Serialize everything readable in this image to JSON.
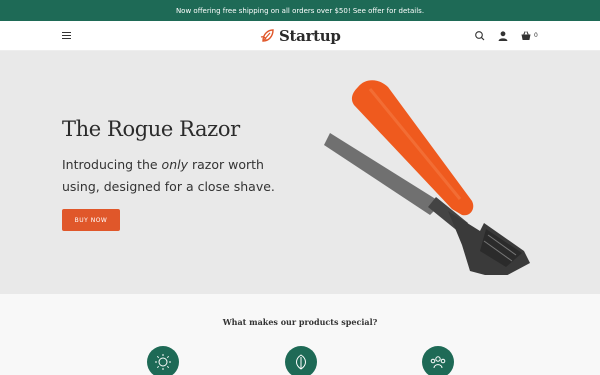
{
  "announcement": {
    "text": "Now offering free shipping on all orders over $50! See offer for details."
  },
  "header": {
    "menu_icon": "hamburger-menu-icon",
    "logo_text": "Startup",
    "logo_icon": "leaf-logo-icon",
    "icons": [
      "search-icon",
      "account-icon",
      "cart-icon"
    ],
    "cart_count": "0"
  },
  "hero": {
    "title": "The Rogue Razor",
    "subtitle_before": "Introducing the ",
    "subtitle_emphasis": "only",
    "subtitle_after": " razor worth using, designed for a close shave.",
    "button_label": "BUY NOW",
    "image": "razor-product-image"
  },
  "features": {
    "title": "What makes our products special?",
    "icons": [
      "sun-icon",
      "leaf-icon",
      "community-icon"
    ]
  },
  "colors": {
    "brand_green": "#1e6a56",
    "accent_orange": "#e0572a",
    "hero_bg": "#e9e9e9"
  }
}
